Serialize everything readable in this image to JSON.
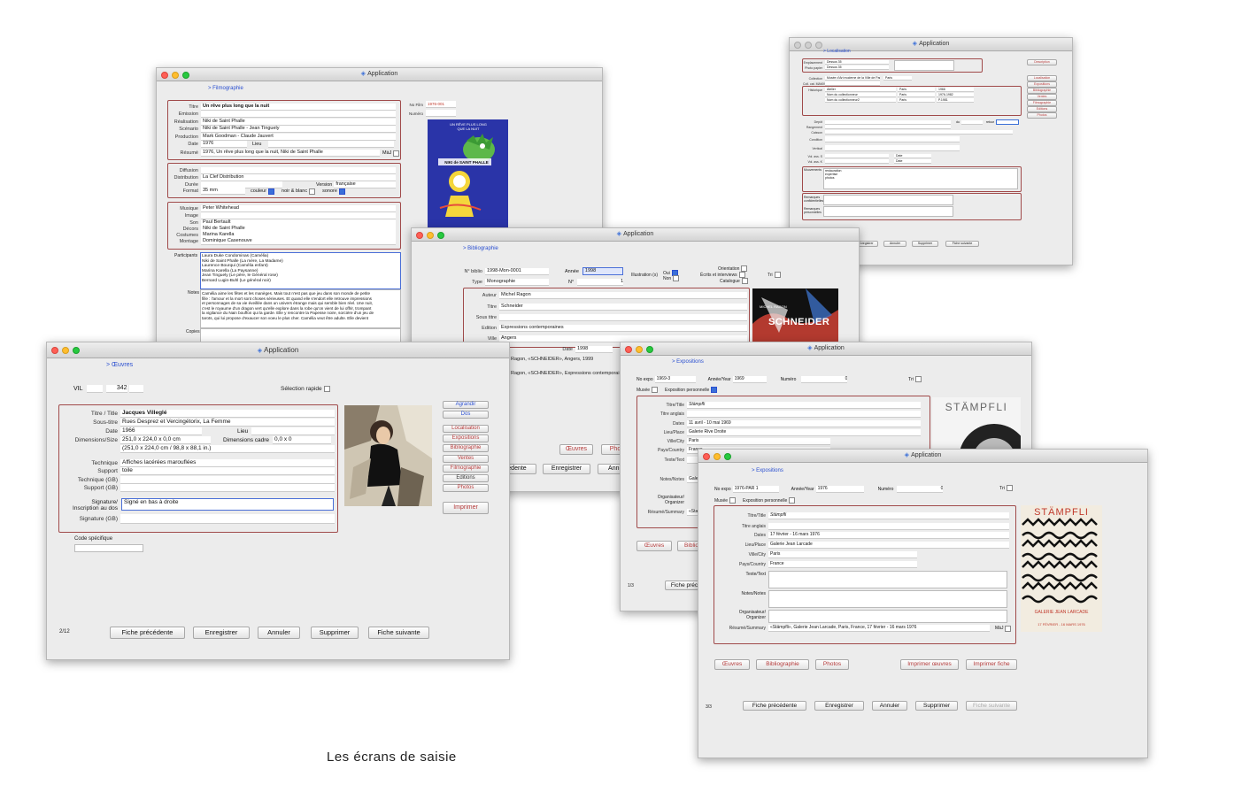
{
  "app_title": "Application",
  "caption": "Les écrans de saisie",
  "w_loc": {
    "section": "> Localisation",
    "rows": [
      {
        "label": "Emplacement",
        "value": "Dessus 35"
      },
      {
        "label": "Photo papier",
        "value": "Dessus 35"
      },
      {
        "label": "Collection",
        "value": "Musée d'Art moderne de la Ville de Paris"
      },
      {
        "label": "Coll. cat. MAMVP",
        "value": ""
      },
      {
        "label": "Historique",
        "value": "Atelier"
      },
      {
        "label": "",
        "value": "Nom du collectionneur"
      },
      {
        "label": "",
        "value": "Nom du collectionneur2"
      }
    ],
    "hist_places": [
      "Paris",
      "Paris",
      "Paris"
    ],
    "hist_years": [
      "1966",
      "1976-1982",
      "P.1981"
    ],
    "fields2": [
      "Depôt",
      "Rangement",
      "Caisson",
      "Vitrine",
      "Condition",
      "Vertical",
      "Vol. ass. S",
      "Vol. ass. K"
    ],
    "du": "du",
    "retour": "retour",
    "mouvements_label": "Mouvements",
    "mouvements_lines": [
      "restauration",
      "expertise",
      "photos"
    ],
    "remarques_label": "Remarques confidentielles",
    "remarques2_label": "Remarques personnelles",
    "side_buttons": [
      "Description",
      "Localisation",
      "Expositions",
      "Bibliographie",
      "Ventes",
      "Filmographie",
      "Editions",
      "Photos"
    ],
    "bottom_buttons": [
      "Enregistrer",
      "Annuler",
      "Supprimer",
      "Fiche suivante"
    ]
  },
  "w_film": {
    "section": "> Filmographie",
    "rows1": [
      {
        "label": "Titre",
        "value": "Un rêve plus long que la nuit"
      },
      {
        "label": "Emission",
        "value": ""
      },
      {
        "label": "Réalisation",
        "value": "Niki de Saint Phalle"
      },
      {
        "label": "Scénario",
        "value": "Niki de Saint Phalle - Jean Tinguely"
      },
      {
        "label": "Production",
        "value": "Mark Goodman - Claude Jauvert"
      },
      {
        "label": "Date",
        "value": "1976"
      },
      {
        "label": "Résumé",
        "value": "1976, Un rêve plus long que la nuit, Niki de Saint Phalle"
      }
    ],
    "lieu_label": "Lieu",
    "maj_label": "MàJ",
    "rows2": [
      {
        "label": "Diffusion",
        "value": ""
      },
      {
        "label": "Distribution",
        "value": "La Clef Distribution"
      },
      {
        "label": "Durée",
        "value": ""
      },
      {
        "label": "Format",
        "value": "35 mm"
      }
    ],
    "version_label": "Version",
    "version_value": "française",
    "couleur": "couleur",
    "noir_blanc": "noir & blanc",
    "sonore": "sonore",
    "rows3": [
      {
        "label": "Musique",
        "value": "Peter Whitehead"
      },
      {
        "label": "Image",
        "value": ""
      },
      {
        "label": "Son",
        "value": "Paul Bertault"
      },
      {
        "label": "Décors",
        "value": "Niki de Saint Phalle"
      },
      {
        "label": "Costumes",
        "value": "Marina Karella"
      },
      {
        "label": "Montage",
        "value": "Dominique Casenouve"
      }
    ],
    "participants_label": "Participants",
    "participants": [
      "Laura Duke Condominas (Camélia)",
      "Niki de Saint Phalle        (La mère, La Madame)",
      "Laurence Bourqui  (Camélia enfant)",
      "Marina Karella        (La Paysanne)",
      "Jean Tinguely        (Le père, le Général rose)",
      "Bernard Lugin-Buhl        (Le général noir)"
    ],
    "notes_label": "Notes",
    "notes": [
      "Camélia aime les fêtes et les manèges. Mais tout n'est pas que jeu dans son monde de petite",
      "fille : l'amour et la mort sont choses sérieuses. Et quand elle s'endort elle retrouve impressions",
      "et personnages de sa vie éveillée dans un univers étrange mais qui semble bien réel. Une nuit,",
      "c'est le royaume d'un dragon vert qu'elle explore dans la robe qu'on vient de lui offrir, trompant",
      "la vigilance du Nain bouffon qui la garde. Elle y rencontre la Papesse noire, sorcière d'un jeu de",
      "tarots, qui lui propose d'exaucer son voeu le plus cher. Camélia veut être adulte. Elle devient"
    ],
    "copies_label": "Copies",
    "no_film_label": "No Film",
    "no_film_value": "1976-001",
    "numero_label": "Numéro",
    "poster_top": "UN RÊVE PLUS LONG QUE LA NUIT",
    "poster_name": "NIKI de SAINT PHALLE"
  },
  "w_biblio": {
    "section": "> Bibliographie",
    "no_biblio_label": "N° biblio",
    "no_biblio_value": "1998-Mon-0001",
    "annee_label": "Année",
    "annee_value": "1998",
    "illus_label": "Illustration (s)",
    "oui": "Oui",
    "non": "Non",
    "type_label": "Type",
    "type_value": "Monographie",
    "num_label": "N°",
    "num_value": "1",
    "orientation": "Orientation",
    "ecrits": "Écrits et interviews",
    "catalogue": "Catalogue",
    "tri": "Tri",
    "rows": [
      {
        "label": "Auteur",
        "value": "Michel Ragon"
      },
      {
        "label": "Titre",
        "value": "Schneider"
      },
      {
        "label": "Sous titre",
        "value": ""
      },
      {
        "label": "Edition",
        "value": "Expressions contemporaines"
      },
      {
        "label": "Ville",
        "value": "Angers"
      }
    ],
    "date_label": "Date",
    "date_value": "1998",
    "ref1": "Ragon, «SCHNEIDER», Angers, 1999",
    "ref2": "Ragon, «SCHNEIDER», Expressions contemporaines, A",
    "cover_title": "SCHNEIDER",
    "cover_author": "MICHEL RAGON",
    "buttons": [
      "Œuvres",
      "Pho"
    ],
    "bottom_buttons": [
      "édente",
      "Enregistrer",
      "Annul"
    ]
  },
  "w_oeuvres": {
    "section": "> Œuvres",
    "vil_label": "VIL",
    "vil_value": "342",
    "selection": "Sélection rapide",
    "rows": [
      {
        "label": "Titre / Title",
        "value": "Jacques Villeglé",
        "bold": true
      },
      {
        "label": "Sous-titre",
        "value": "Rues Desprez et Vercingétorix, La Femme"
      },
      {
        "label": "Date",
        "value": "1966"
      },
      {
        "label": "Dimensions/Size",
        "value": "251,0 x 224,0 x  0,0   cm"
      },
      {
        "label": "",
        "value": "(251,0 x 224,0 cm / 98,8 x 88,1 in.)"
      }
    ],
    "lieu": "Lieu",
    "dim_cadre": "Dimensions cadre",
    "dim_cadre_value": "0,0  x   0",
    "rows2": [
      {
        "label": "Technique",
        "value": "Affiches lacérées marouflées"
      },
      {
        "label": "Support",
        "value": "toile"
      },
      {
        "label": "Technique (GB)",
        "value": ""
      },
      {
        "label": "Support (GB)",
        "value": ""
      }
    ],
    "sig_label1": "Signature/",
    "sig_label2": "Inscription au dos",
    "sig_value": "Signé en bas à droite",
    "sig_gb_label": "Signature (GB)",
    "code_label": "Code spécifique",
    "side_buttons": [
      "Agrandir",
      "Dos",
      "Localisation",
      "Expositions",
      "Bibliographie",
      "Ventes",
      "Filmographie",
      "Editions",
      "Photos"
    ],
    "imprimer": "Imprimer",
    "pager": "2/12",
    "bottom_buttons": [
      "Fiche précédente",
      "Enregistrer",
      "Annuler",
      "Supprimer",
      "Fiche suivante"
    ]
  },
  "w_expo1": {
    "section": "> Expositions",
    "no_expo_label": "No expo",
    "no_expo_value": "1969-3",
    "annee_label": "Année/Year",
    "annee_value": "1969",
    "numero_label": "Numéro",
    "numero_value": "0",
    "tri": "Tri",
    "musee": "Musée",
    "expo_perso": "Exposition personnelle",
    "rows": [
      {
        "label": "Titre/Title",
        "value": "Stämpfli"
      },
      {
        "label": "Titre anglais",
        "value": ""
      },
      {
        "label": "Dates",
        "value": "11 avril - 10 mai 1969"
      },
      {
        "label": "Lieu/Place",
        "value": "Galerie Rive Droite"
      },
      {
        "label": "Ville/City",
        "value": "Paris"
      },
      {
        "label": "Pays/Country",
        "value": "France"
      },
      {
        "label": "Texte/Text",
        "value": ""
      }
    ],
    "notes_label": "Notes/Notes",
    "notes_value": "Gale",
    "organisateur": "Organisateur/ Organizer",
    "resume": "Résumé/Summary",
    "resume_value": "«Stam",
    "logo": "STÄMPFLI",
    "buttons": [
      "Œuvres",
      "Biblio"
    ],
    "pager": "1/3",
    "bottom_button": "Fiche préc"
  },
  "w_expo2": {
    "section": "> Expositions",
    "no_expo_label": "No expo",
    "no_expo_value": "1976-PAR 1",
    "annee_label": "Année/Year",
    "annee_value": "1976",
    "numero_label": "Numéro",
    "numero_value": "0",
    "tri": "Tri",
    "musee": "Musée",
    "expo_perso": "Exposition personnelle",
    "rows": [
      {
        "label": "Titre/Title",
        "value": "Stämpfli",
        "italic": true
      },
      {
        "label": "Titre anglais",
        "value": ""
      },
      {
        "label": "Dates",
        "value": "17 février - 16 mars 1976"
      },
      {
        "label": "Lieu/Place",
        "value": "Galerie Jean Larcade"
      },
      {
        "label": "Ville/City",
        "value": "Paris"
      },
      {
        "label": "Pays/Country",
        "value": "France"
      }
    ],
    "texte_label": "Texte/Text",
    "notes_label": "Notes/Notes",
    "organisateur1": "Organisateur/",
    "organisateur2": "Organizer",
    "resume_label": "Résumé/Summary",
    "resume_value": "«Stämpfli», Galerie Jean Larcade, Paris, France, 17 février - 16 mars 1976",
    "maj": "MàJ",
    "poster_title": "STÄMPFLI",
    "poster_gallery": "GALERIE JEAN LARCADE",
    "poster_dates": "17 FÉVRIER - 16 MARS 1976",
    "buttons": [
      "Œuvres",
      "Bibliographie",
      "Photos",
      "Imprimer œuvres",
      "Imprimer fiche"
    ],
    "pager": "3/3",
    "bottom_buttons": [
      "Fiche précédente",
      "Enregistrer",
      "Annuler",
      "Supprimer",
      "Fiche suivante"
    ]
  }
}
